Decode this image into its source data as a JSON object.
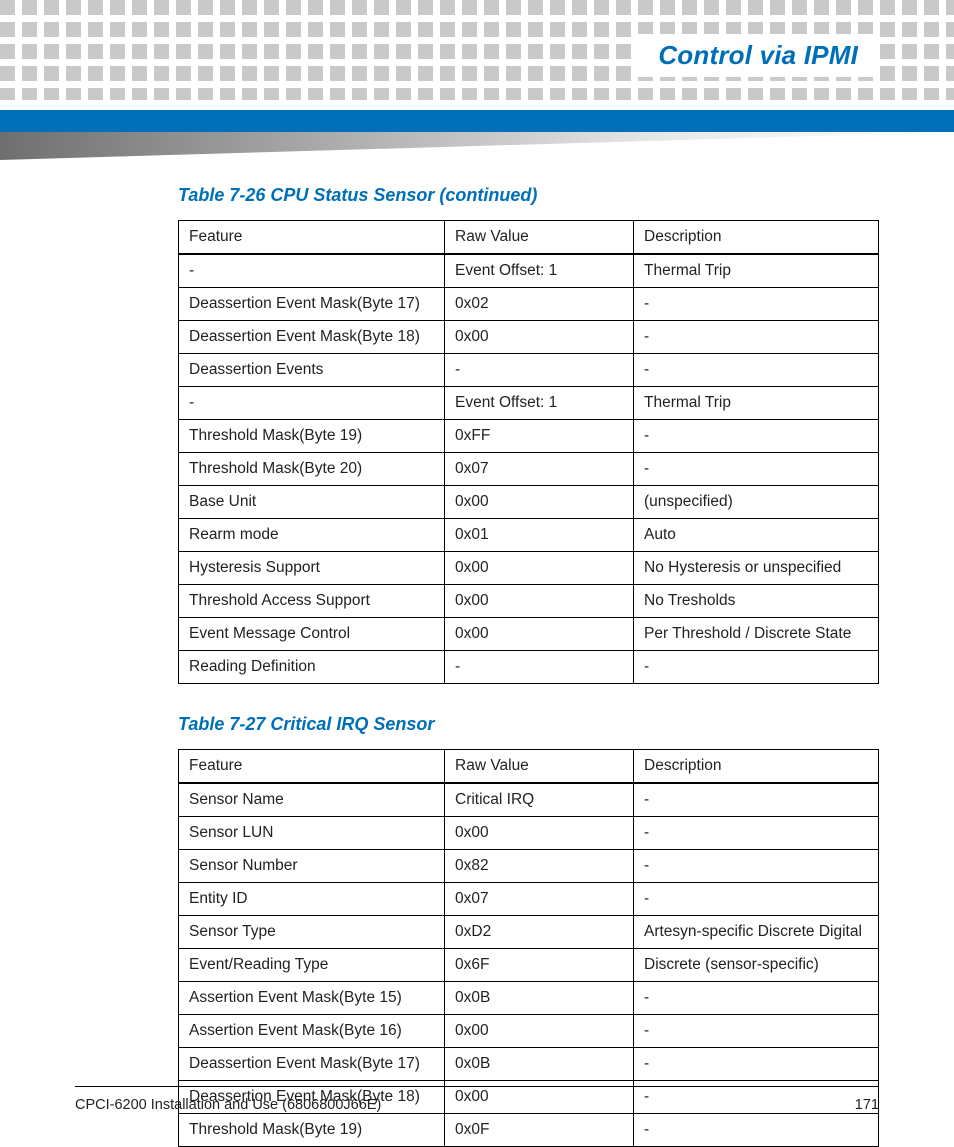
{
  "header": {
    "title": "Control via IPMI"
  },
  "table1": {
    "caption": "Table 7-26 CPU Status Sensor (continued)",
    "columns": [
      "Feature",
      "Raw Value",
      "Description"
    ],
    "rows": [
      [
        "-",
        "Event Offset: 1",
        "Thermal Trip"
      ],
      [
        "Deassertion Event Mask(Byte 17)",
        "0x02",
        "-"
      ],
      [
        "Deassertion Event Mask(Byte 18)",
        "0x00",
        "-"
      ],
      [
        "Deassertion Events",
        "-",
        "-"
      ],
      [
        "-",
        "Event Offset: 1",
        "Thermal Trip"
      ],
      [
        "Threshold Mask(Byte 19)",
        "0xFF",
        "-"
      ],
      [
        "Threshold Mask(Byte 20)",
        "0x07",
        "-"
      ],
      [
        "Base Unit",
        "0x00",
        "(unspecified)"
      ],
      [
        "Rearm mode",
        "0x01",
        "Auto"
      ],
      [
        "Hysteresis Support",
        "0x00",
        "No Hysteresis or unspecified"
      ],
      [
        "Threshold Access Support",
        "0x00",
        "No Tresholds"
      ],
      [
        "Event Message Control",
        "0x00",
        "Per Threshold / Discrete State"
      ],
      [
        "Reading Definition",
        "-",
        "-"
      ]
    ]
  },
  "table2": {
    "caption": "Table 7-27 Critical IRQ Sensor",
    "columns": [
      "Feature",
      "Raw Value",
      "Description"
    ],
    "rows": [
      [
        "Sensor Name",
        "Critical IRQ",
        "-"
      ],
      [
        "Sensor LUN",
        "0x00",
        "-"
      ],
      [
        "Sensor Number",
        "0x82",
        "-"
      ],
      [
        "Entity ID",
        "0x07",
        "-"
      ],
      [
        "Sensor Type",
        "0xD2",
        "Artesyn-specific Discrete Digital"
      ],
      [
        "Event/Reading Type",
        "0x6F",
        "Discrete (sensor-specific)"
      ],
      [
        "Assertion Event Mask(Byte 15)",
        "0x0B",
        "-"
      ],
      [
        "Assertion Event Mask(Byte 16)",
        "0x00",
        "-"
      ],
      [
        "Deassertion Event Mask(Byte 17)",
        "0x0B",
        "-"
      ],
      [
        "Deassertion Event Mask(Byte 18)",
        "0x00",
        "-"
      ],
      [
        "Threshold Mask(Byte 19)",
        "0x0F",
        "-"
      ]
    ]
  },
  "footer": {
    "left": "CPCI-6200 Installation and Use (6806800J66E)",
    "right": "171"
  }
}
